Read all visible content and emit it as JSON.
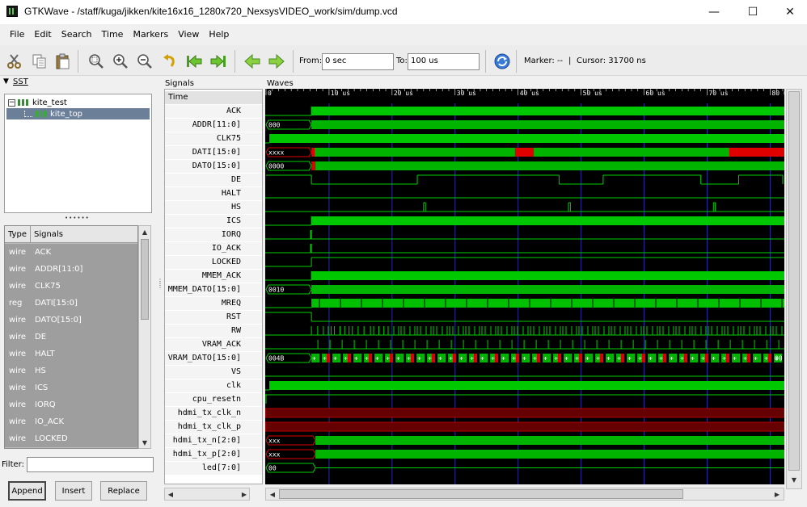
{
  "window": {
    "title": "GTKWave - /staff/kuga/jikken/kite16x16_1280x720_NexsysVIDEO_work/sim/dump.vcd",
    "minimize": "—",
    "maximize": "☐",
    "close": "✕"
  },
  "menu": [
    "File",
    "Edit",
    "Search",
    "Time",
    "Markers",
    "View",
    "Help"
  ],
  "toolbar": {
    "icons": [
      "cut-icon",
      "copy-icon",
      "paste-icon",
      "zoom-fit-icon",
      "zoom-in-icon",
      "zoom-out-icon",
      "undo-icon",
      "zoom-start-icon",
      "zoom-end-icon",
      "prev-edge-icon",
      "next-edge-icon"
    ],
    "from_label": "From:",
    "from_value": "0 sec",
    "to_label": "To:",
    "to_value": "100 us",
    "refresh_icon": "refresh-icon",
    "marker_label": "Marker: --",
    "cursor_sep": "|",
    "cursor_label": "Cursor: 31700 ns"
  },
  "sst": {
    "title": "SST",
    "tree": [
      {
        "label": "kite_test",
        "expanded": true,
        "expander": "−"
      },
      {
        "label": "kite_top",
        "selected": true
      }
    ],
    "splitter": "••••••"
  },
  "type_list": {
    "col_type": "Type",
    "col_signals": "Signals",
    "rows": [
      {
        "type": "wire",
        "name": "ACK"
      },
      {
        "type": "wire",
        "name": "ADDR[11:0]"
      },
      {
        "type": "wire",
        "name": "CLK75"
      },
      {
        "type": "reg",
        "name": "DATI[15:0]"
      },
      {
        "type": "wire",
        "name": "DATO[15:0]"
      },
      {
        "type": "wire",
        "name": "DE"
      },
      {
        "type": "wire",
        "name": "HALT"
      },
      {
        "type": "wire",
        "name": "HS"
      },
      {
        "type": "wire",
        "name": "ICS"
      },
      {
        "type": "wire",
        "name": "IORQ"
      },
      {
        "type": "wire",
        "name": "IO_ACK"
      },
      {
        "type": "wire",
        "name": "LOCKED"
      }
    ]
  },
  "filter": {
    "label": "Filter:",
    "value": ""
  },
  "buttons": {
    "append": "Append",
    "insert": "Insert",
    "replace": "Replace"
  },
  "signals_pane": {
    "title": "Signals",
    "time_header": "Time",
    "signals": [
      "ACK",
      "ADDR[11:0]",
      "CLK75",
      "DATI[15:0]",
      "DATO[15:0]",
      "DE",
      "HALT",
      "HS",
      "ICS",
      "IORQ",
      "IO_ACK",
      "LOCKED",
      "MMEM_ACK",
      "MMEM_DATO[15:0]",
      "MREQ",
      "RST",
      "RW",
      "VRAM_ACK",
      "VRAM_DATO[15:0]",
      "VS",
      "clk",
      "cpu_resetn",
      "hdmi_tx_clk_n",
      "hdmi_tx_clk_p",
      "hdmi_tx_n[2:0]",
      "hdmi_tx_p[2:0]",
      "led[7:0]"
    ]
  },
  "waves_pane": {
    "title": "Waves",
    "tick_labels": [
      "0",
      "10 us",
      "20 us",
      "30 us",
      "40 us",
      "50 us",
      "60 us",
      "70 us",
      "80 us"
    ],
    "tick_values_us": [
      0,
      10,
      20,
      30,
      40,
      50,
      60,
      70,
      80
    ],
    "visible_range_us": [
      0,
      82
    ],
    "bus_labels": {
      "ADDR[11:0]": "000",
      "DATI[15:0]": "xxxx",
      "DATO[15:0]": "0000",
      "MMEM_DATO[15:0]": "0010",
      "VRAM_DATO[15:0]": "004B",
      "hdmi_tx_n[2:0]": "xxx",
      "hdmi_tx_p[2:0]": "xxx",
      "led[7:0]": "00"
    },
    "vram_change_label": "+",
    "vram_end_label": "00",
    "colors": {
      "wave": "#00d000",
      "bus_fill": "#00b400",
      "undefined": "#e00000",
      "grid": "#2a2aa0",
      "bg": "#000000"
    }
  }
}
